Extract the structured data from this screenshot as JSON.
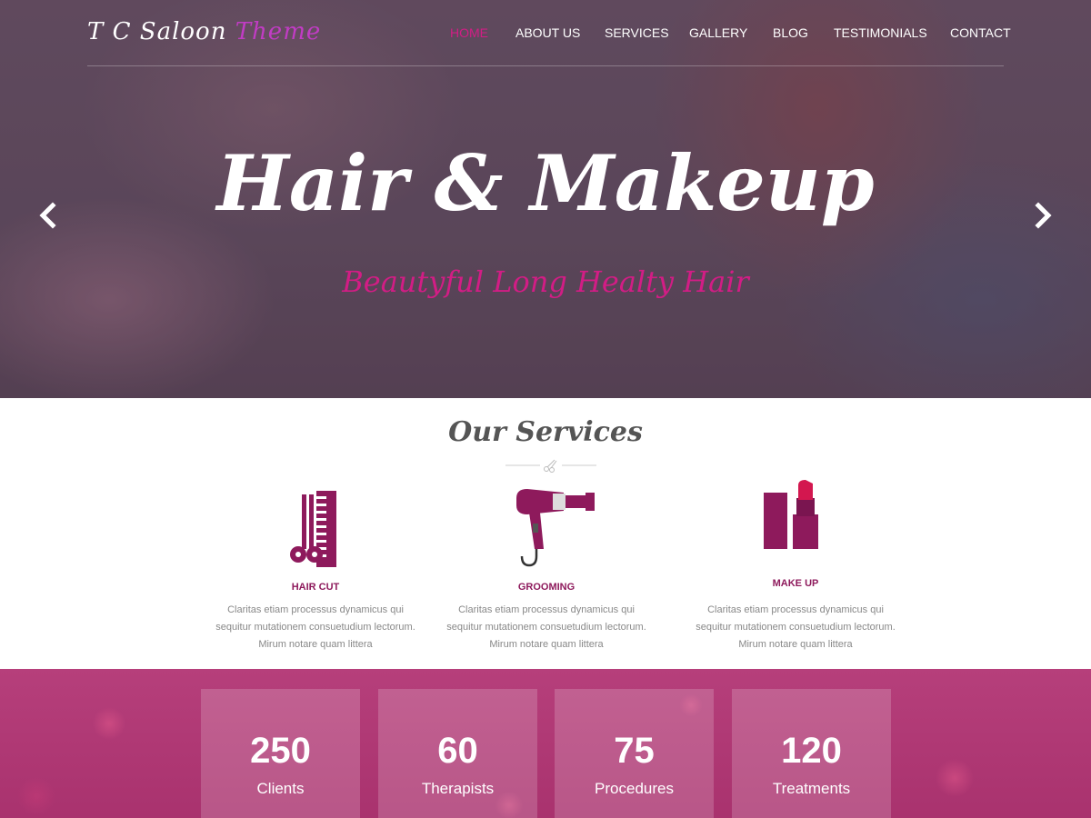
{
  "logo": {
    "text_main": "T C  Saloon",
    "text_accent": "Theme"
  },
  "nav": {
    "items": [
      {
        "label": "HOME"
      },
      {
        "label": "ABOUT US"
      },
      {
        "label": "SERVICES"
      },
      {
        "label": "GALLERY"
      },
      {
        "label": "BLOG"
      },
      {
        "label": "TESTIMONIALS"
      },
      {
        "label": "CONTACT"
      }
    ],
    "active_label": "HOME"
  },
  "hero": {
    "title": "Hair & Makeup",
    "subtitle": "Beautyful Long Healty Hair"
  },
  "services": {
    "title": "Our Services",
    "items": [
      {
        "name": "HAIR CUT",
        "icon": "comb-scissors-icon",
        "description": "Claritas etiam processus dynamicus qui sequitur mutationem consuetudium lectorum. Mirum notare quam littera"
      },
      {
        "name": "GROOMING",
        "icon": "hair-dryer-icon",
        "description": "Claritas etiam processus dynamicus qui sequitur mutationem consuetudium lectorum. Mirum notare quam littera"
      },
      {
        "name": "MAKE UP",
        "icon": "lipstick-icon",
        "description": "Claritas etiam processus dynamicus qui sequitur mutationem consuetudium lectorum. Mirum notare quam littera"
      }
    ]
  },
  "stats": [
    {
      "value": "250",
      "label": "Clients"
    },
    {
      "value": "60",
      "label": "Therapists"
    },
    {
      "value": "75",
      "label": "Procedures"
    },
    {
      "value": "120",
      "label": "Treatments"
    }
  ],
  "colors": {
    "accent": "#d21d85",
    "service_name": "#8e1a5c",
    "stats_bg": "#b03a74",
    "icon_purple": "#8e1a5c"
  }
}
